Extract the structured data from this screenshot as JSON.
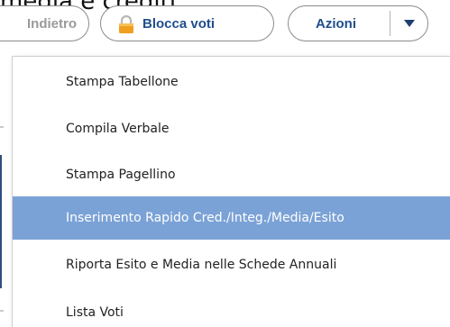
{
  "caption": "media e crediti\":",
  "toolbar": {
    "back_label": "Indietro",
    "lock_label": "Blocca voti",
    "actions_label": "Azioni"
  },
  "icons": {
    "lock": "lock-icon",
    "dropdown": "caret-down-icon"
  },
  "colors": {
    "accent": "#1f4e8c",
    "highlight": "#7ba2d6",
    "lock": "#f0a020"
  },
  "menu": {
    "items": [
      {
        "label": "Stampa Tabellone"
      },
      {
        "label": "Compila Verbale"
      },
      {
        "label": "Stampa Pagellino"
      },
      {
        "label": "Inserimento Rapido Cred./Integ./Media/Esito"
      },
      {
        "label": "Riporta Esito e Media nelle Schede Annuali"
      },
      {
        "label": "Lista Voti"
      }
    ],
    "highlighted_index": 3
  }
}
